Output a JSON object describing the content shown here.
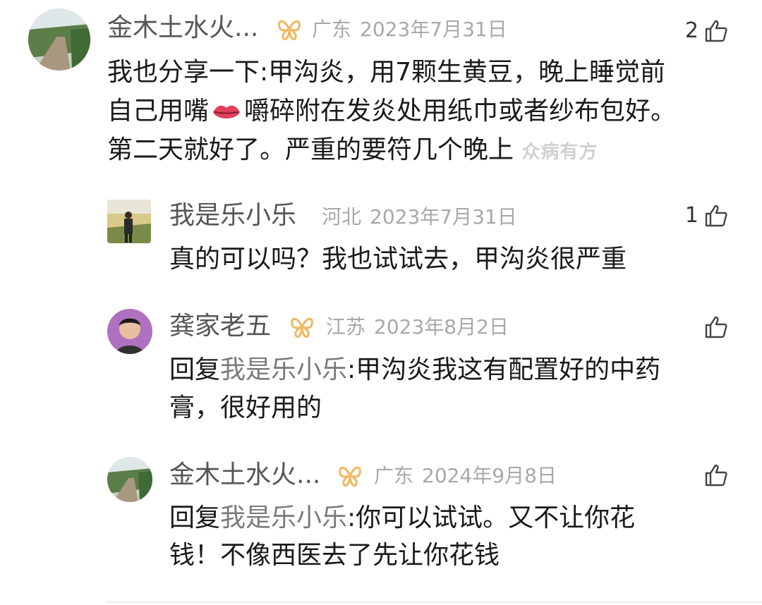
{
  "comments": [
    {
      "user": "金木土水火...",
      "region": "广东",
      "date": "2023年7月31日",
      "likes": "2",
      "lines": [
        "我也分享一下:甲沟炎，用7颗生黄豆，晚上睡觉前",
        "自己用嘴",
        "嚼碎附在发炎处用纸巾或者纱布包好。",
        "第二天就好了。严重的要符几个晚上"
      ],
      "watermark": "众病有方"
    }
  ],
  "replies": [
    {
      "user": "我是乐小乐",
      "region": "河北",
      "date": "2023年7月31日",
      "likes": "1",
      "lines": [
        "真的可以吗？我也试试去，甲沟炎很严重"
      ]
    },
    {
      "user": "龚家老五",
      "region": "江苏",
      "date": "2023年8月2日",
      "likes": "",
      "reply_prefix": "回复",
      "mention": "我是乐小乐",
      "lines": [
        ":甲沟炎我这有配置好的中药",
        "膏，很好用的"
      ]
    },
    {
      "user": "金木土水火...",
      "region": "广东",
      "date": "2024年9月8日",
      "likes": "",
      "reply_prefix": "回复",
      "mention": "我是乐小乐",
      "lines": [
        ":你可以试试。又不让你花",
        "钱！不像西医去了先让你花钱"
      ]
    }
  ],
  "icons": {
    "like": "thumbs-up-icon",
    "badge": "butterfly-badge-icon",
    "lips": "lips-emoji-icon"
  },
  "colors": {
    "username": "#555555",
    "meta": "#a8a8a8",
    "mention": "#7a7a7a",
    "badge": "#f0b860",
    "lips": "#e0405a"
  }
}
